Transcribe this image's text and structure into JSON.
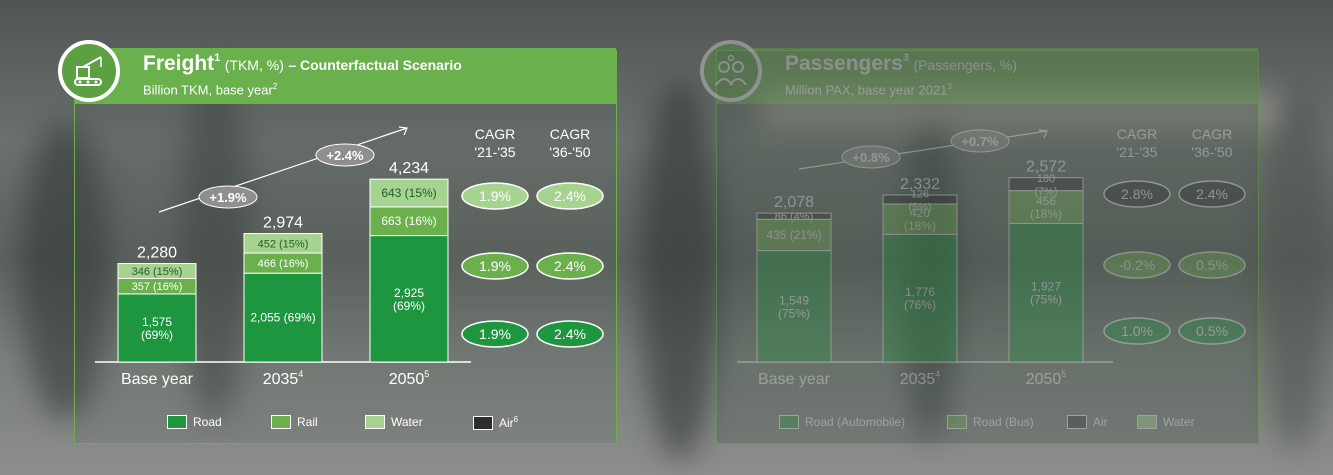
{
  "freight": {
    "title": "Freight",
    "title_sup": "1",
    "units": "(TKM, %)",
    "scenario": "– Counterfactual Scenario",
    "subtitle": "Billion TKM, base year",
    "subtitle_sup": "2",
    "icon": "crane-truck-icon",
    "cagr_headers": [
      {
        "line1": "CAGR",
        "line2": "'21-'35"
      },
      {
        "line1": "CAGR",
        "line2": "'36-'50"
      }
    ],
    "cagr_rows": [
      {
        "row": "water",
        "a": "1.9%",
        "b": "2.4%"
      },
      {
        "row": "rail",
        "a": "1.9%",
        "b": "2.4%"
      },
      {
        "row": "road",
        "a": "1.9%",
        "b": "2.4%"
      }
    ],
    "growth_bubbles": [
      "+1.9%",
      "+2.4%"
    ],
    "legend": [
      {
        "label": "Road",
        "color": "#1e9640"
      },
      {
        "label": "Rail",
        "color": "#6ab04c"
      },
      {
        "label": "Water",
        "color": "#a6d38f"
      },
      {
        "label": "Air",
        "label_sup": "6",
        "color": "#2d2d2d"
      }
    ]
  },
  "passengers": {
    "title": "Passengers",
    "title_sup": "3",
    "units": "(Passengers, %)",
    "subtitle": "Million PAX, base year 2021",
    "subtitle_sup": "3",
    "icon": "people-group-icon",
    "cagr_headers": [
      {
        "line1": "CAGR",
        "line2": "'21-'35"
      },
      {
        "line1": "CAGR",
        "line2": "'36-'50"
      }
    ],
    "cagr_rows": [
      {
        "row": "air",
        "a": "2.8%",
        "b": "2.4%"
      },
      {
        "row": "bus",
        "a": "-0.2%",
        "b": "0.5%"
      },
      {
        "row": "auto",
        "a": "1.0%",
        "b": "0.5%"
      }
    ],
    "growth_bubbles": [
      "+0.8%",
      "+0.7%"
    ],
    "legend": [
      {
        "label": "Road (Automobile)",
        "color": "#1e9640"
      },
      {
        "label": "Road (Bus)",
        "color": "#6ab04c"
      },
      {
        "label": "Air",
        "color": "#2d2d2d"
      },
      {
        "label": "Water",
        "color": "#a6d38f"
      }
    ]
  },
  "chart_data": [
    {
      "type": "bar",
      "stacked": true,
      "title": "Freight (TKM, %) – Counterfactual Scenario",
      "subtitle": "Billion TKM, base year",
      "categories": [
        "Base year",
        "2035",
        "2050"
      ],
      "category_sups": [
        "",
        "4",
        "5"
      ],
      "totals": [
        "2,280",
        "2,974",
        "4,234"
      ],
      "series": [
        {
          "name": "Road",
          "color": "#1e9640",
          "values": [
            1575,
            2055,
            2925
          ],
          "labels": [
            "1,575\n(69%)",
            "2,055 (69%)",
            "2,925\n(69%)"
          ]
        },
        {
          "name": "Rail",
          "color": "#6ab04c",
          "values": [
            357,
            466,
            663
          ],
          "labels": [
            "357 (16%)",
            "466 (16%)",
            "663 (16%)"
          ]
        },
        {
          "name": "Water",
          "color": "#a6d38f",
          "values": [
            346,
            452,
            643
          ],
          "labels": [
            "346 (15%)",
            "452 (15%)",
            "643 (15%)"
          ]
        }
      ],
      "ylim": [
        0,
        4234
      ]
    },
    {
      "type": "bar",
      "stacked": true,
      "title": "Passengers (Passengers, %)",
      "subtitle": "Million PAX, base year 2021",
      "categories": [
        "Base year",
        "2035",
        "2050"
      ],
      "category_sups": [
        "",
        "4",
        "5"
      ],
      "totals": [
        "2,078",
        "2,332",
        "2,572"
      ],
      "series": [
        {
          "name": "Road (Automobile)",
          "color": "#1e9640",
          "values": [
            1549,
            1776,
            1927
          ],
          "labels": [
            "1,549\n(75%)",
            "1,776\n(76%)",
            "1,927\n(75%)"
          ]
        },
        {
          "name": "Road (Bus)",
          "color": "#6ab04c",
          "values": [
            435,
            420,
            456
          ],
          "labels": [
            "435 (21%)",
            "420\n(18%)",
            "456\n(18%)"
          ]
        },
        {
          "name": "Air",
          "color": "#2d2d2d",
          "values": [
            86,
            126,
            180
          ],
          "labels": [
            "86 (4%)",
            "126\n(5%)",
            "180\n(7%)"
          ]
        }
      ],
      "ylim": [
        0,
        2572
      ]
    }
  ]
}
